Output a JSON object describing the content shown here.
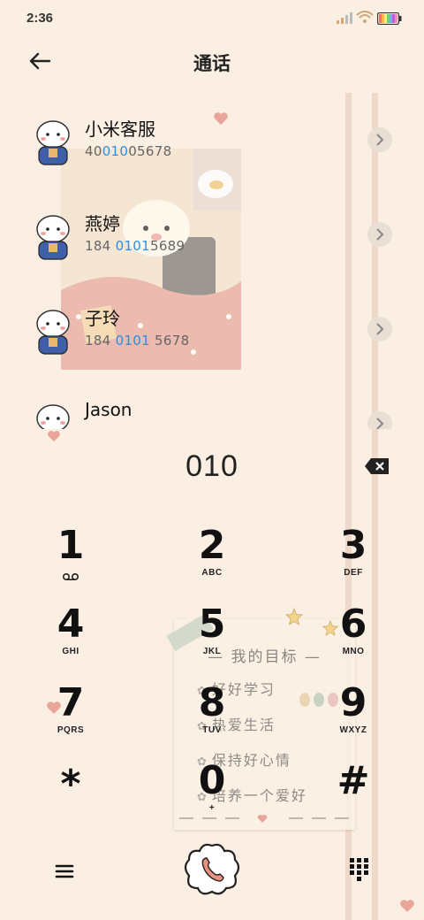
{
  "status": {
    "time": "2:36"
  },
  "header": {
    "title": "通话"
  },
  "contacts": [
    {
      "name": "小米客服",
      "num_pre": "40",
      "num_hl": "010",
      "num_post": "05678"
    },
    {
      "name": "燕婷",
      "num_pre": "184 ",
      "num_hl": "0101",
      "num_post": "5689"
    },
    {
      "name": "子玲",
      "num_pre": "184 ",
      "num_hl": "0101",
      "num_post": " 5678"
    },
    {
      "name": "Jason",
      "num_pre": "",
      "num_hl": "",
      "num_post": ""
    }
  ],
  "dial": {
    "number": "010"
  },
  "keypad": [
    {
      "digit": "1",
      "letters": ""
    },
    {
      "digit": "2",
      "letters": "ABC"
    },
    {
      "digit": "3",
      "letters": "DEF"
    },
    {
      "digit": "4",
      "letters": "GHI"
    },
    {
      "digit": "5",
      "letters": "JKL"
    },
    {
      "digit": "6",
      "letters": "MNO"
    },
    {
      "digit": "7",
      "letters": "PQRS"
    },
    {
      "digit": "8",
      "letters": "TUV"
    },
    {
      "digit": "9",
      "letters": "WXYZ"
    },
    {
      "digit": "*",
      "letters": ""
    },
    {
      "digit": "0",
      "letters": "+"
    },
    {
      "digit": "#",
      "letters": ""
    }
  ],
  "note": {
    "title": "— 我的目标 —",
    "items": [
      "好好学习",
      "热爱生活",
      "保持好心情",
      "培养一个爱好"
    ]
  },
  "colors": {
    "background": "#fbeee2",
    "highlight": "#2b8fe0",
    "stripe": "#eed8c9"
  }
}
